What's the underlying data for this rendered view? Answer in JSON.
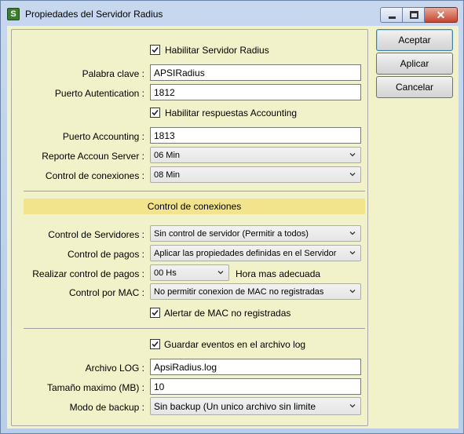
{
  "window": {
    "title": "Propiedades del Servidor Radius",
    "icon": "app-icon",
    "controls": [
      "minimize",
      "maximize",
      "close"
    ]
  },
  "buttons": {
    "accept": "Aceptar",
    "apply": "Aplicar",
    "cancel": "Cancelar"
  },
  "radius": {
    "enable_label": "Habilitar Servidor Radius",
    "enable_checked": true,
    "password_label": "Palabra clave :",
    "password_value": "APSIRadius",
    "auth_port_label": "Puerto Autentication :",
    "auth_port_value": "1812",
    "accounting_enable_label": "Habilitar respuestas Accounting",
    "accounting_enable_checked": true,
    "accounting_port_label": "Puerto Accounting :",
    "accounting_port_value": "1813",
    "report_label": "Reporte Accoun Server :",
    "report_value": "06 Min",
    "conn_control_label": "Control de conexiones :",
    "conn_control_value": "08 Min"
  },
  "connections": {
    "section_title": "Control de conexiones",
    "servers_label": "Control de Servidores :",
    "servers_value": "Sin control de servidor (Permitir a todos)",
    "payments_label": "Control de pagos :",
    "payments_value": "Aplicar las propiedades definidas en el Servidor",
    "payments_time_label": "Realizar control de pagos :",
    "payments_time_value": "00 Hs",
    "payments_time_hint": "Hora mas adecuada",
    "mac_label": "Control por MAC :",
    "mac_value": "No permitir conexion de MAC no registradas",
    "mac_alert_label": "Alertar de MAC no registradas",
    "mac_alert_checked": true
  },
  "log": {
    "save_label": "Guardar eventos en el archivo log",
    "save_checked": true,
    "file_label": "Archivo LOG :",
    "file_value": "ApsiRadius.log",
    "maxsize_label": "Tamaño maximo (MB) :",
    "maxsize_value": "10",
    "backup_label": "Modo de backup :",
    "backup_value": "Sin backup (Un unico archivo sin limite"
  },
  "colors": {
    "client_bg": "#f2f2ca",
    "section_header_bg": "#f2e48c",
    "title_bar": "#c6d7ee",
    "close_button": "#c8452f"
  }
}
